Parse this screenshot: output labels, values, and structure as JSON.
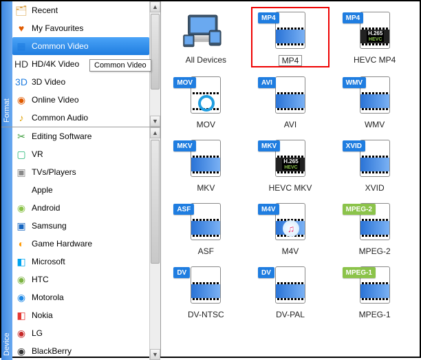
{
  "sidebar": {
    "format_tab": "Format",
    "device_tab": "Device",
    "format_items": [
      {
        "label": "Recent",
        "icon": "🗂",
        "color": "#d69a3a"
      },
      {
        "label": "My Favourites",
        "icon": "♥",
        "color": "#e05a00"
      },
      {
        "label": "Common Video",
        "icon": "▦",
        "color": "#1f7de0",
        "selected": true
      },
      {
        "label": "HD/4K Video",
        "icon": "HD",
        "color": "#333"
      },
      {
        "label": "3D Video",
        "icon": "3D",
        "color": "#1f7de0"
      },
      {
        "label": "Online Video",
        "icon": "◉",
        "color": "#e05a00"
      },
      {
        "label": "Common Audio",
        "icon": "♪",
        "color": "#e0a000"
      }
    ],
    "device_items": [
      {
        "label": "Editing Software",
        "icon": "✂",
        "color": "#3a9c3a"
      },
      {
        "label": "VR",
        "icon": "▢",
        "color": "#20b573"
      },
      {
        "label": "TVs/Players",
        "icon": "▣",
        "color": "#888"
      },
      {
        "label": "Apple",
        "icon": "",
        "color": "#888"
      },
      {
        "label": "Android",
        "icon": "◉",
        "color": "#8bc34a"
      },
      {
        "label": "Samsung",
        "icon": "▣",
        "color": "#1565c0"
      },
      {
        "label": "Game Hardware",
        "icon": "◐",
        "color": "#ff9800"
      },
      {
        "label": "Microsoft",
        "icon": "◧",
        "color": "#00a4ef"
      },
      {
        "label": "HTC",
        "icon": "◉",
        "color": "#7cb342"
      },
      {
        "label": "Motorola",
        "icon": "◉",
        "color": "#1e88e5"
      },
      {
        "label": "Nokia",
        "icon": "◧",
        "color": "#e53935"
      },
      {
        "label": "LG",
        "icon": "◉",
        "color": "#c62828"
      },
      {
        "label": "BlackBerry",
        "icon": "◉",
        "color": "#333"
      }
    ]
  },
  "tooltip": "Common Video",
  "grid": [
    {
      "label": "All Devices",
      "type": "alldevices"
    },
    {
      "label": "MP4",
      "badge": "MP4",
      "badge_bg": "#1f7de0",
      "highlight": true
    },
    {
      "label": "HEVC MP4",
      "badge": "MP4",
      "badge_bg": "#1f7de0",
      "sub": "H.265",
      "sub2": "HEVC",
      "dark": true
    },
    {
      "label": "MOV",
      "badge": "MOV",
      "badge_bg": "#1f7de0",
      "q": true
    },
    {
      "label": "AVI",
      "badge": "AVI",
      "badge_bg": "#1f7de0"
    },
    {
      "label": "WMV",
      "badge": "WMV",
      "badge_bg": "#1f7de0"
    },
    {
      "label": "MKV",
      "badge": "MKV",
      "badge_bg": "#1f7de0",
      "mat": true
    },
    {
      "label": "HEVC MKV",
      "badge": "MKV",
      "badge_bg": "#1f7de0",
      "sub": "H.265",
      "sub2": "HEVC",
      "dark": true
    },
    {
      "label": "XVID",
      "badge": "XVID",
      "badge_bg": "#1f7de0"
    },
    {
      "label": "ASF",
      "badge": "ASF",
      "badge_bg": "#1f7de0"
    },
    {
      "label": "M4V",
      "badge": "M4V",
      "badge_bg": "#1f7de0",
      "note": true
    },
    {
      "label": "MPEG-2",
      "badge": "MPEG-2",
      "badge_bg": "#8bc34a"
    },
    {
      "label": "DV-NTSC",
      "badge": "DV",
      "badge_bg": "#1f7de0"
    },
    {
      "label": "DV-PAL",
      "badge": "DV",
      "badge_bg": "#1f7de0"
    },
    {
      "label": "MPEG-1",
      "badge": "MPEG-1",
      "badge_bg": "#8bc34a"
    }
  ]
}
